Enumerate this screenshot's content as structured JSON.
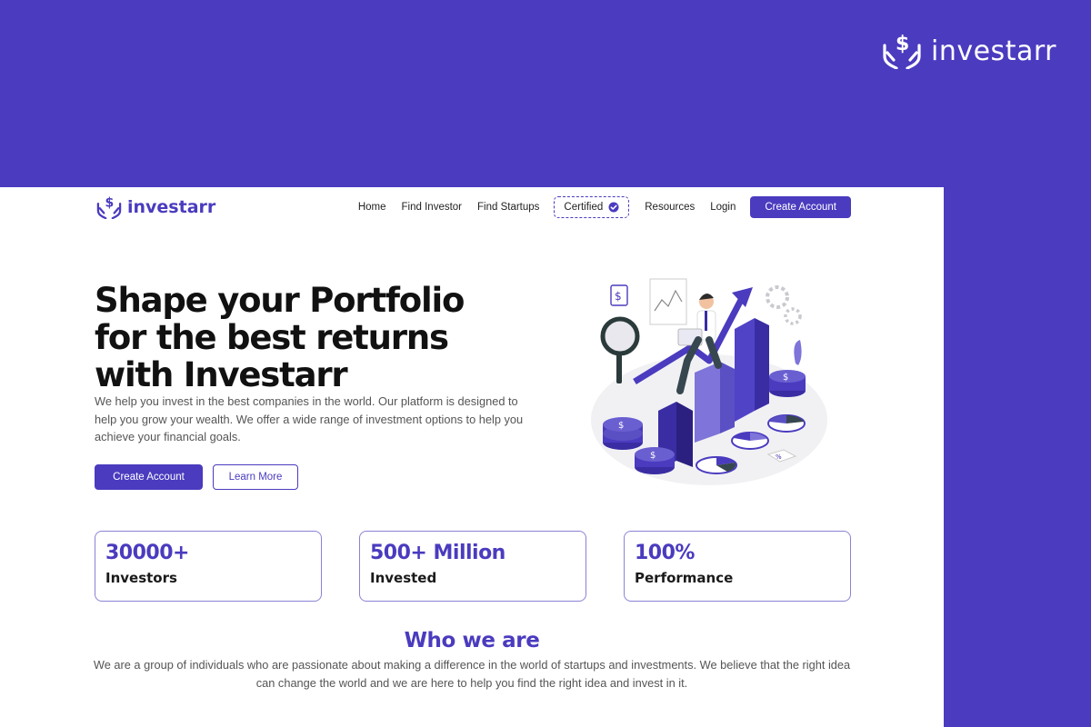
{
  "brand": {
    "name": "investarr",
    "primary_color": "#4a3bbf"
  },
  "nav": {
    "links": [
      "Home",
      "Find Investor",
      "Find Startups"
    ],
    "certified_label": "Certified",
    "resources": "Resources",
    "login": "Login",
    "create_account": "Create Account"
  },
  "hero": {
    "title_lines": [
      "Shape your Portfolio",
      "for the best returns",
      "with Investarr"
    ],
    "description": "We help you invest in the best companies in the world. Our platform is designed to help you grow your wealth. We offer a wide range of investment options to help you achieve your financial goals.",
    "primary_button": "Create Account",
    "secondary_button": "Learn More"
  },
  "stats": [
    {
      "value": "30000+",
      "label": "Investors"
    },
    {
      "value": "500+ Million",
      "label": "Invested"
    },
    {
      "value": "100%",
      "label": "Performance"
    }
  ],
  "about": {
    "title": "Who we are",
    "description": "We are a group of individuals who are passionate about making a difference in the world of startups and investments. We believe that the right idea can change the world and we are here to help you find the right idea and invest in it."
  },
  "icons": {
    "logo": "hands-dollar-icon",
    "certified": "verified-check-icon"
  }
}
